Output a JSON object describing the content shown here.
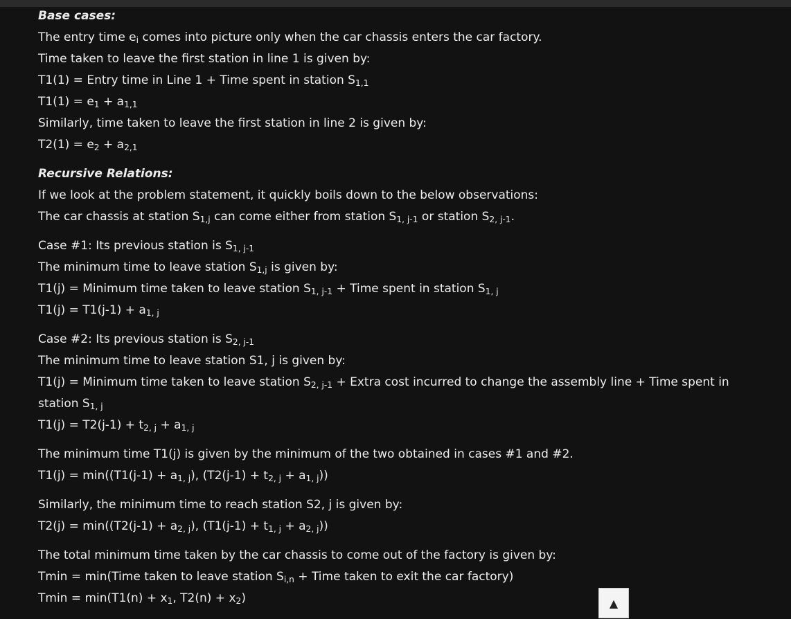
{
  "colors": {
    "background": "#121212",
    "text": "#ececec",
    "topbar": "#2b2b2b",
    "button": "#f4f4f4"
  },
  "lines": [
    "Base cases:",
    "The entry time e<sub>i</sub> comes into picture only when the car chassis enters the car factory.",
    "Time taken to leave the first station in line 1 is given by:",
    "T1(1) = Entry time in Line 1 + Time spent in station S<sub>1,1</sub>",
    "T1(1) = e<sub>1</sub> + a<sub>1,1</sub>",
    "Similarly, time taken to leave the first station in line 2 is given by:",
    "T2(1) = e<sub>2</sub> + a<sub>2,1</sub>",
    "Recursive Relations:",
    "If we look at the problem statement, it quickly boils down to the below observations:",
    "The car chassis at station S<sub>1,j</sub> can come either from station S<sub>1, j-1</sub> or station S<sub>2, j-1</sub>.",
    "Case #1: Its previous station is S<sub>1, j-1</sub>",
    "The minimum time to leave station S<sub>1,j</sub> is given by:",
    "T1(j) = Minimum time taken to leave station S<sub>1, j-1</sub> + Time spent in station S<sub>1, j</sub>",
    "T1(j) = T1(j-1) + a<sub>1, j</sub>",
    "Case #2: Its previous station is S<sub>2, j-1</sub>",
    "The minimum time to leave station S1, j is given by:",
    "T1(j) = Minimum time taken to leave station S<sub>2, j-1</sub> + Extra cost incurred to change the assembly line + Time spent in",
    "station S<sub>1, j</sub>",
    "T1(j) = T2(j-1) + t<sub>2, j</sub> + a<sub>1, j</sub>",
    "The minimum time T1(j) is given by the minimum of the two obtained in cases #1 and #2.",
    "T1(j) = min((T1(j-1) + a<sub>1, j</sub>), (T2(j-1) + t<sub>2, j</sub> + a<sub>1, j</sub>))",
    "Similarly, the minimum time to reach station S2, j is given by:",
    "T2(j) = min((T2(j-1) + a<sub>2, j</sub>), (T1(j-1) + t<sub>1, j</sub> + a<sub>2, j</sub>))",
    "The total minimum time taken by the car chassis to come out of the factory is given by:",
    "Tmin = min(Time taken to leave station S<sub>i,n</sub> + Time taken to exit the car factory)",
    "Tmin = min(T1(n) + x<sub>1</sub>, T2(n) + x<sub>2</sub>)"
  ],
  "scroll_button": {
    "icon": "up-triangle-icon",
    "glyph": "▲"
  }
}
